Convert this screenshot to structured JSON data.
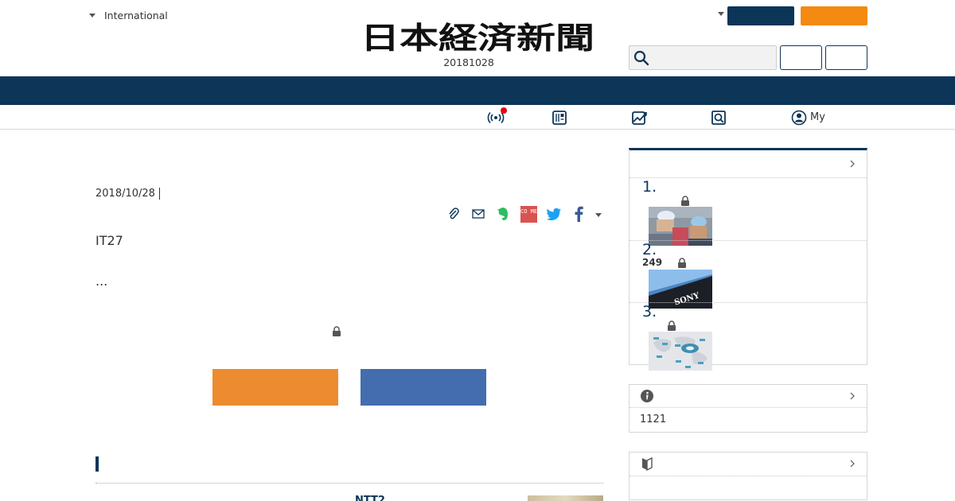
{
  "header": {
    "edition_label": "International",
    "logo_text": "日本経済新聞",
    "issue_date": "20181028",
    "search_placeholder": "",
    "colors": {
      "navy": "#0d3558",
      "orange": "#f48a12"
    }
  },
  "icon_nav": {
    "items": [
      {
        "icon": "live-broadcast-icon",
        "label": ""
      },
      {
        "icon": "newspaper-viewer-icon",
        "label": ""
      },
      {
        "icon": "market-chart-icon",
        "label": ""
      },
      {
        "icon": "search-article-icon",
        "label": ""
      },
      {
        "icon": "my-account-icon",
        "label": "My"
      }
    ]
  },
  "article": {
    "date": "2018/10/28",
    "lead": "IT27",
    "ellipsis": "...",
    "share_icons": [
      "clip-icon",
      "mail-icon",
      "evernote-icon",
      "come-icon",
      "twitter-icon",
      "facebook-icon"
    ],
    "come_text": "CO ME",
    "cta_colors": [
      "#ed8b30",
      "#436daf"
    ]
  },
  "related": {
    "title": "NTT2"
  },
  "ranking": {
    "items": [
      {
        "rank": "1.",
        "sub": "",
        "thumb": "workers-photo"
      },
      {
        "rank": "2.",
        "sub": "249",
        "thumb": "sony-sign-photo"
      },
      {
        "rank": "3.",
        "sub": "",
        "thumb": "world-map-diagram"
      }
    ],
    "thumb_sign_text": "SONY"
  },
  "info_box": {
    "text": "1121"
  }
}
